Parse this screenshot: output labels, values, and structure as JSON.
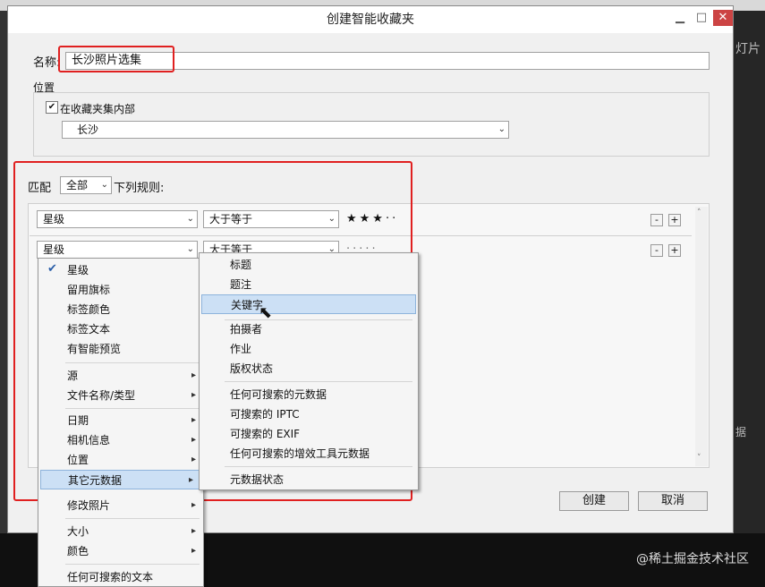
{
  "dialog": {
    "title": "创建智能收藏夹",
    "name_label": "名称:",
    "name_value": "长沙照片选集",
    "location_label": "位置",
    "inside_collection_label": "在收藏夹集内部",
    "collection_value": "长沙",
    "match_label": "匹配",
    "match_value": "全部",
    "match_suffix": "下列规则:",
    "create_label": "创建",
    "cancel_label": "取消"
  },
  "rules": [
    {
      "field": "星级",
      "operator": "大于等于",
      "value": "★★★··"
    },
    {
      "field": "星级",
      "operator": "大于等于",
      "value": "·····"
    }
  ],
  "rule_buttons": {
    "minus": "-",
    "plus": "+"
  },
  "field_menu": {
    "items": [
      "星级",
      "留用旗标",
      "标签颜色",
      "标签文本",
      "有智能预览",
      "源",
      "文件名称/类型",
      "日期",
      "相机信息",
      "位置",
      "其它元数据",
      "修改照片",
      "大小",
      "颜色",
      "任何可搜索的文本"
    ],
    "checked": "星级",
    "selected": "其它元数据"
  },
  "submenu": {
    "items": [
      "标题",
      "题注",
      "关键字",
      "拍摄者",
      "作业",
      "版权状态",
      "任何可搜索的元数据",
      "可搜索的 IPTC",
      "可搜索的 EXIF",
      "任何可搜索的增效工具元数据",
      "元数据状态"
    ],
    "hovered": "关键字"
  },
  "background": {
    "right_label": "灯片",
    "right_label2": "据"
  },
  "watermark": "@稀土掘金技术社区",
  "colors": {
    "highlight": "#e02020",
    "menu_selected": "#cce0f5"
  }
}
